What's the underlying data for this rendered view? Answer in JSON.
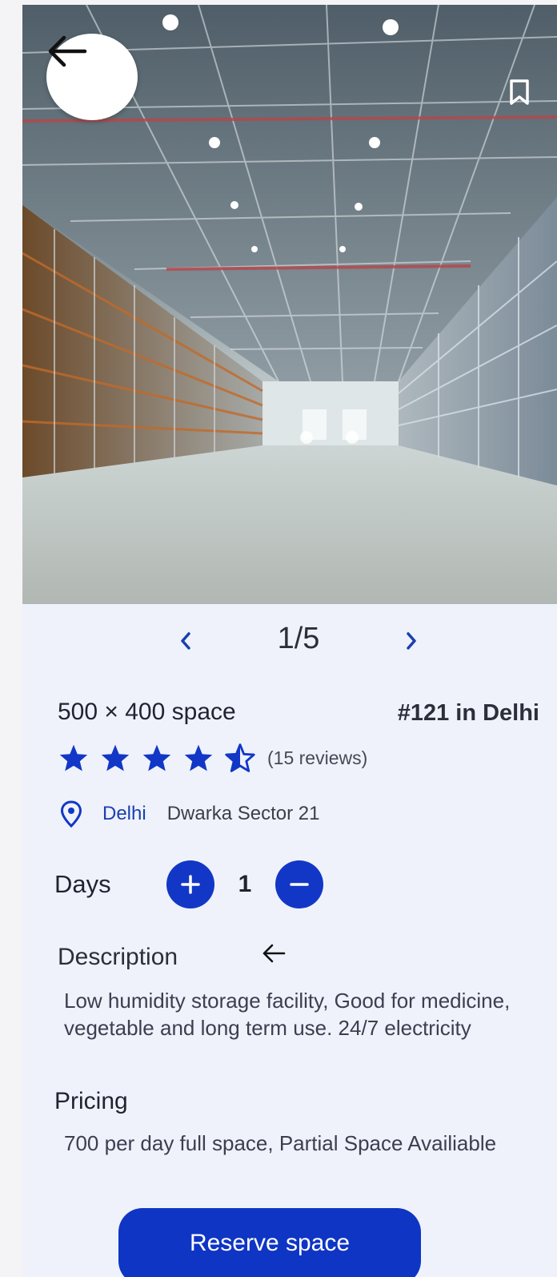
{
  "gallery": {
    "current": "1/5",
    "image_alt": "Warehouse interior"
  },
  "listing": {
    "title": "500 × 400 space",
    "rank": "#121 in Delhi",
    "rating": 4.5,
    "reviews": "(15 reviews)",
    "city": "Delhi",
    "area": "Dwarka Sector 21"
  },
  "days": {
    "label": "Days",
    "value": "1"
  },
  "description": {
    "heading": "Description",
    "text": "Low humidity storage facility, Good for medicine, vegetable and long term use. 24/7 electricity"
  },
  "pricing": {
    "heading": "Pricing",
    "text": "700 per day full space, Partial Space Availiable"
  },
  "actions": {
    "reserve_label": "Reserve space"
  },
  "colors": {
    "accent": "#1237c7",
    "background": "#eff2fb"
  }
}
